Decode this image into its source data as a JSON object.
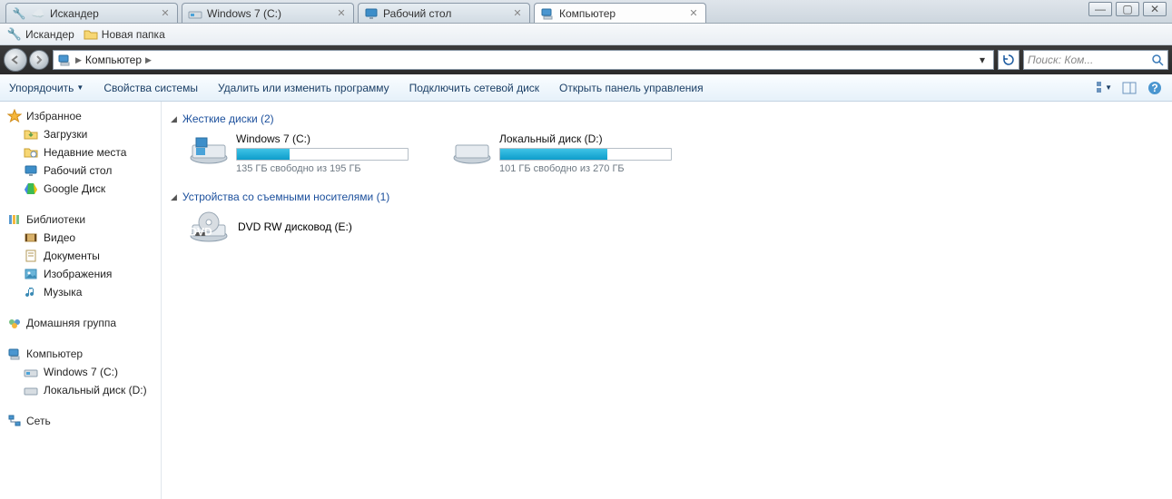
{
  "tabs": [
    {
      "label": "Искандер",
      "icon": "cloud"
    },
    {
      "label": "Windows 7 (C:)",
      "icon": "drive"
    },
    {
      "label": "Рабочий стол",
      "icon": "monitor"
    },
    {
      "label": "Компьютер",
      "icon": "computer",
      "active": true
    }
  ],
  "bookmarks": [
    {
      "label": "Искандер",
      "icon": "wrench"
    },
    {
      "label": "Новая папка",
      "icon": "folder"
    }
  ],
  "address": {
    "root": "Компьютер"
  },
  "search": {
    "placeholder": "Поиск: Ком..."
  },
  "toolbar": {
    "organize": "Упорядочить",
    "props": "Свойства системы",
    "uninstall": "Удалить или изменить программу",
    "netdrive": "Подключить сетевой диск",
    "cpanel": "Открыть панель управления"
  },
  "sidebar": {
    "favorites": {
      "title": "Избранное",
      "items": [
        {
          "label": "Загрузки",
          "icon": "download"
        },
        {
          "label": "Недавние места",
          "icon": "recent"
        },
        {
          "label": "Рабочий стол",
          "icon": "monitor"
        },
        {
          "label": "Google Диск",
          "icon": "gdrive"
        }
      ]
    },
    "libraries": {
      "title": "Библиотеки",
      "items": [
        {
          "label": "Видео",
          "icon": "video"
        },
        {
          "label": "Документы",
          "icon": "docs"
        },
        {
          "label": "Изображения",
          "icon": "images"
        },
        {
          "label": "Музыка",
          "icon": "music"
        }
      ]
    },
    "homegroup": {
      "title": "Домашняя группа"
    },
    "computer": {
      "title": "Компьютер",
      "items": [
        {
          "label": "Windows 7 (C:)",
          "icon": "drive"
        },
        {
          "label": "Локальный диск (D:)",
          "icon": "drive"
        }
      ]
    },
    "network": {
      "title": "Сеть"
    }
  },
  "content": {
    "hdd_header": "Жесткие диски (2)",
    "removable_header": "Устройства со съемными носителями (1)",
    "drives": [
      {
        "label": "Windows 7 (C:)",
        "sub": "135 ГБ свободно из 195 ГБ",
        "fill": 31
      },
      {
        "label": "Локальный диск (D:)",
        "sub": "101 ГБ свободно из 270 ГБ",
        "fill": 63
      }
    ],
    "dvd": {
      "label": "DVD RW дисковод (E:)"
    }
  }
}
